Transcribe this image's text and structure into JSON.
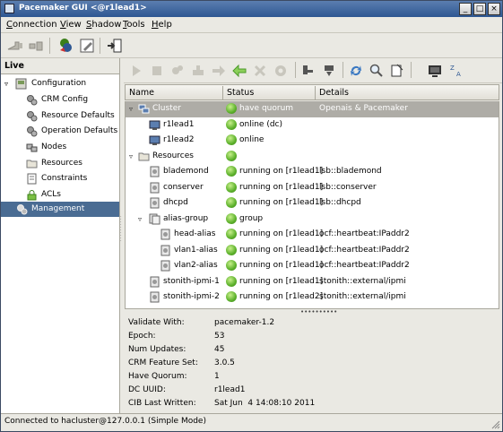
{
  "window": {
    "title": "Pacemaker GUI <@r1lead1>"
  },
  "menu": {
    "items": [
      {
        "label": "Connection",
        "mnemonic": "C",
        "rest": "onnection"
      },
      {
        "label": "View",
        "mnemonic": "V",
        "rest": "iew"
      },
      {
        "label": "Shadow",
        "mnemonic": "S",
        "rest": "hadow"
      },
      {
        "label": "Tools",
        "mnemonic": "T",
        "rest": "ools"
      },
      {
        "label": "Help",
        "mnemonic": "H",
        "rest": "elp"
      }
    ]
  },
  "left": {
    "header": "Live",
    "tree": [
      {
        "label": "Configuration"
      },
      {
        "label": "CRM Config"
      },
      {
        "label": "Resource Defaults"
      },
      {
        "label": "Operation Defaults"
      },
      {
        "label": "Nodes"
      },
      {
        "label": "Resources"
      },
      {
        "label": "Constraints"
      },
      {
        "label": "ACLs"
      },
      {
        "label": "Management"
      }
    ]
  },
  "columns": {
    "name": "Name",
    "status": "Status",
    "details": "Details"
  },
  "rows": [
    {
      "name": "Cluster",
      "status": "have quorum",
      "details": "Openais & Pacemaker"
    },
    {
      "name": "r1lead1",
      "status": "online (dc)",
      "details": ""
    },
    {
      "name": "r1lead2",
      "status": "online",
      "details": ""
    },
    {
      "name": "Resources",
      "status": "",
      "details": ""
    },
    {
      "name": "blademond",
      "status": "running on [r1lead1]",
      "details": "lsb::blademond"
    },
    {
      "name": "conserver",
      "status": "running on [r1lead1]",
      "details": "lsb::conserver"
    },
    {
      "name": "dhcpd",
      "status": "running on [r1lead1]",
      "details": "lsb::dhcpd"
    },
    {
      "name": "alias-group",
      "status": "group",
      "details": ""
    },
    {
      "name": "head-alias",
      "status": "running on [r1lead1]",
      "details": "ocf::heartbeat:IPaddr2"
    },
    {
      "name": "vlan1-alias",
      "status": "running on [r1lead1]",
      "details": "ocf::heartbeat:IPaddr2"
    },
    {
      "name": "vlan2-alias",
      "status": "running on [r1lead1]",
      "details": "ocf::heartbeat:IPaddr2"
    },
    {
      "name": "stonith-ipmi-1",
      "status": "running on [r1lead1]",
      "details": "stonith::external/ipmi"
    },
    {
      "name": "stonith-ipmi-2",
      "status": "running on [r1lead2]",
      "details": "stonith::external/ipmi"
    }
  ],
  "properties": [
    {
      "key": "Validate With:",
      "value": "pacemaker-1.2"
    },
    {
      "key": "Epoch:",
      "value": "53"
    },
    {
      "key": "Num Updates:",
      "value": "45"
    },
    {
      "key": "CRM Feature Set:",
      "value": "3.0.5"
    },
    {
      "key": "Have Quorum:",
      "value": "1"
    },
    {
      "key": "DC UUID:",
      "value": "r1lead1"
    },
    {
      "key": "CIB Last Written:",
      "value": "Sat Jun  4 14:08:10 2011"
    }
  ],
  "status_bar": "Connected to hacluster@127.0.0.1 (Simple Mode)",
  "colors": {
    "selection": "#4a6c93",
    "titlebar": "#2e5792",
    "status_ok": "#5bb02a"
  }
}
